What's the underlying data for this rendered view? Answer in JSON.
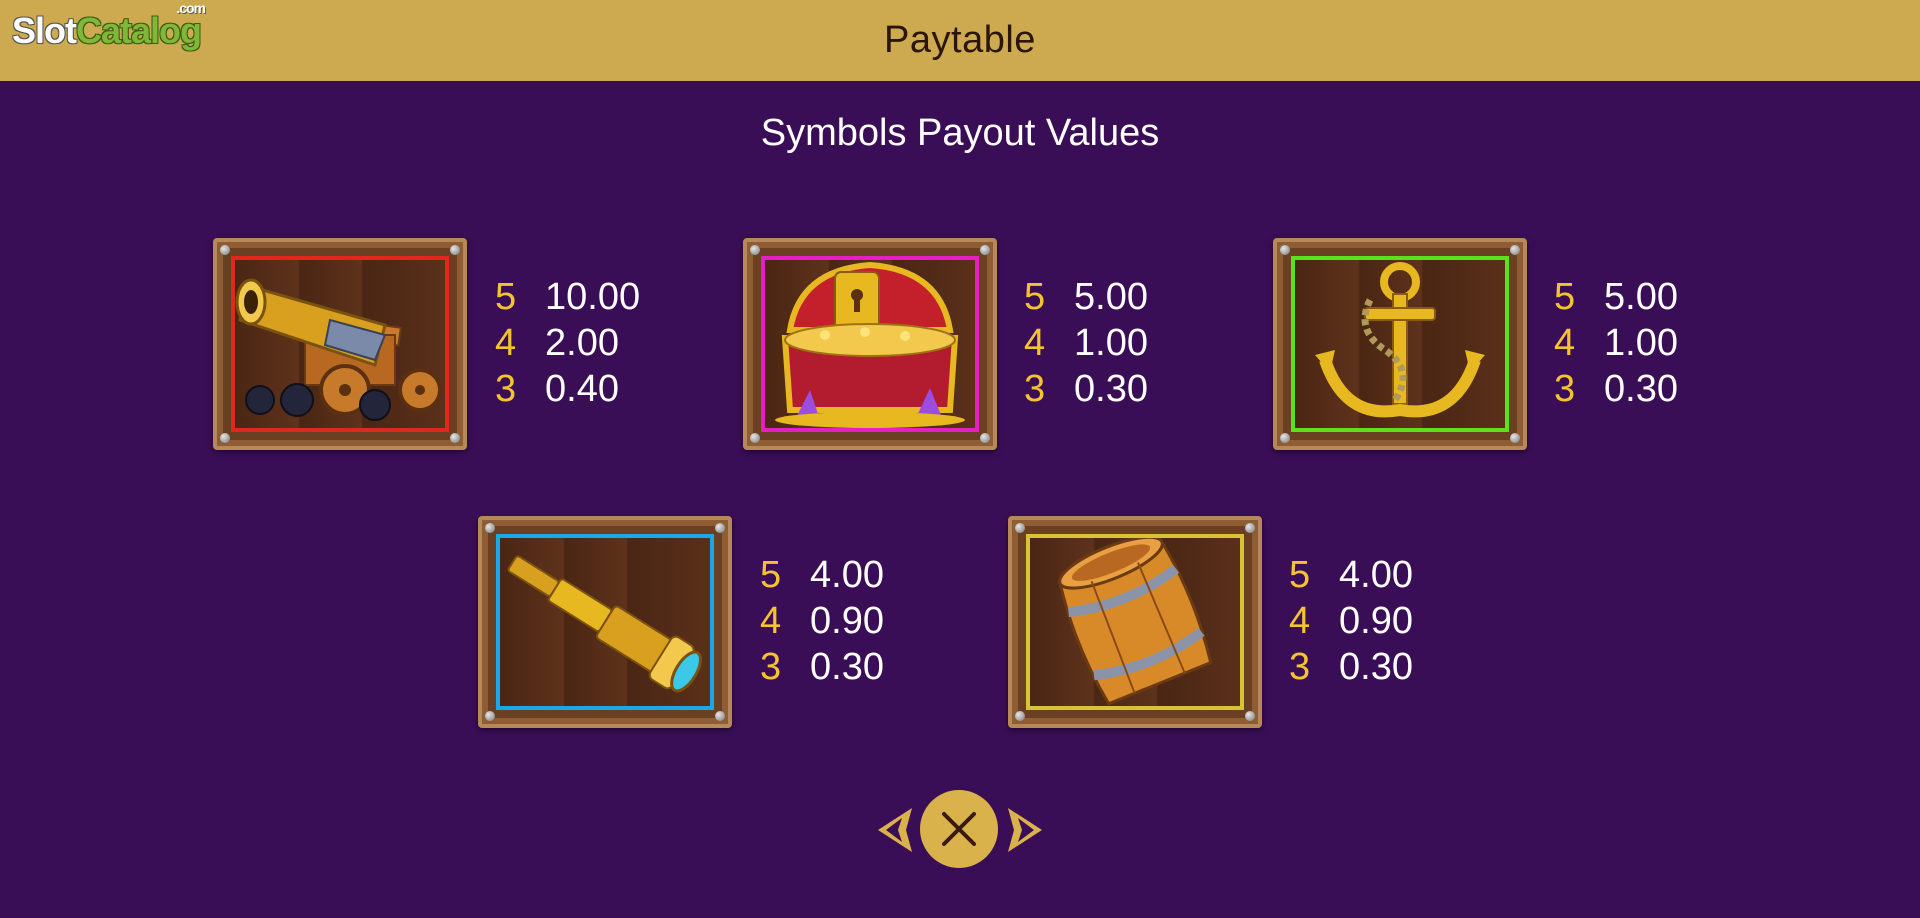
{
  "logo": {
    "slot": "Slot",
    "catalog": "Catalog",
    "com": ".com"
  },
  "header": {
    "title": "Paytable"
  },
  "subtitle": "Symbols Payout Values",
  "colors": {
    "background": "#3a0e57",
    "header": "#cdaa50",
    "count": "#f4c430",
    "value": "#ffffff"
  },
  "symbols": [
    {
      "icon": "cannon-icon",
      "frame_color": "#e0281c",
      "payouts": [
        {
          "count": "5",
          "value": "10.00"
        },
        {
          "count": "4",
          "value": "2.00"
        },
        {
          "count": "3",
          "value": "0.40"
        }
      ]
    },
    {
      "icon": "treasure-chest-icon",
      "frame_color": "#e51fc4",
      "payouts": [
        {
          "count": "5",
          "value": "5.00"
        },
        {
          "count": "4",
          "value": "1.00"
        },
        {
          "count": "3",
          "value": "0.30"
        }
      ]
    },
    {
      "icon": "anchor-icon",
      "frame_color": "#5ce21a",
      "payouts": [
        {
          "count": "5",
          "value": "5.00"
        },
        {
          "count": "4",
          "value": "1.00"
        },
        {
          "count": "3",
          "value": "0.30"
        }
      ]
    },
    {
      "icon": "spyglass-icon",
      "frame_color": "#1aa9e8",
      "payouts": [
        {
          "count": "5",
          "value": "4.00"
        },
        {
          "count": "4",
          "value": "0.90"
        },
        {
          "count": "3",
          "value": "0.30"
        }
      ]
    },
    {
      "icon": "barrel-icon",
      "frame_color": "#d9c233",
      "payouts": [
        {
          "count": "5",
          "value": "4.00"
        },
        {
          "count": "4",
          "value": "0.90"
        },
        {
          "count": "3",
          "value": "0.30"
        }
      ]
    }
  ],
  "navigation": {
    "prev_icon": "chevron-left-icon",
    "close_icon": "close-icon",
    "next_icon": "chevron-right-icon"
  }
}
